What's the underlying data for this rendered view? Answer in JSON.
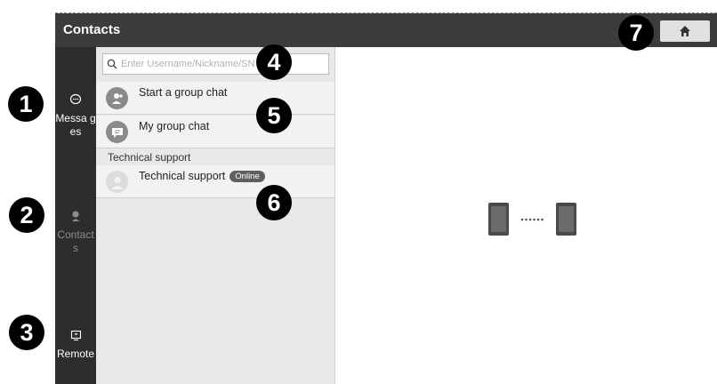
{
  "header": {
    "title": "Contacts",
    "home_icon": "home-icon"
  },
  "rail": {
    "items": [
      {
        "label": "Messa ges",
        "icon": "chat-bubble-icon",
        "active": true
      },
      {
        "label": "Contact s",
        "icon": "contacts-icon",
        "active": false
      },
      {
        "label": "Remote",
        "icon": "remote-screen-icon",
        "active": true
      }
    ]
  },
  "search": {
    "placeholder": "Enter Username/Nickname/SN"
  },
  "list": {
    "items": [
      {
        "label": "Start a group chat",
        "icon": "add-group-icon"
      },
      {
        "label": "My group chat",
        "icon": "group-chat-icon"
      }
    ],
    "section_header": "Technical support",
    "contact": {
      "name": "Technical support",
      "status": "Online"
    }
  },
  "illustration": {
    "icon": "device-connect-icon"
  },
  "markers": [
    "1",
    "2",
    "3",
    "4",
    "5",
    "6",
    "7"
  ],
  "colors": {
    "titlebar": "#3c3c3c",
    "rail": "#2d2d2d",
    "panel": "#e8e8e8",
    "badge": "#5f5f5f"
  }
}
